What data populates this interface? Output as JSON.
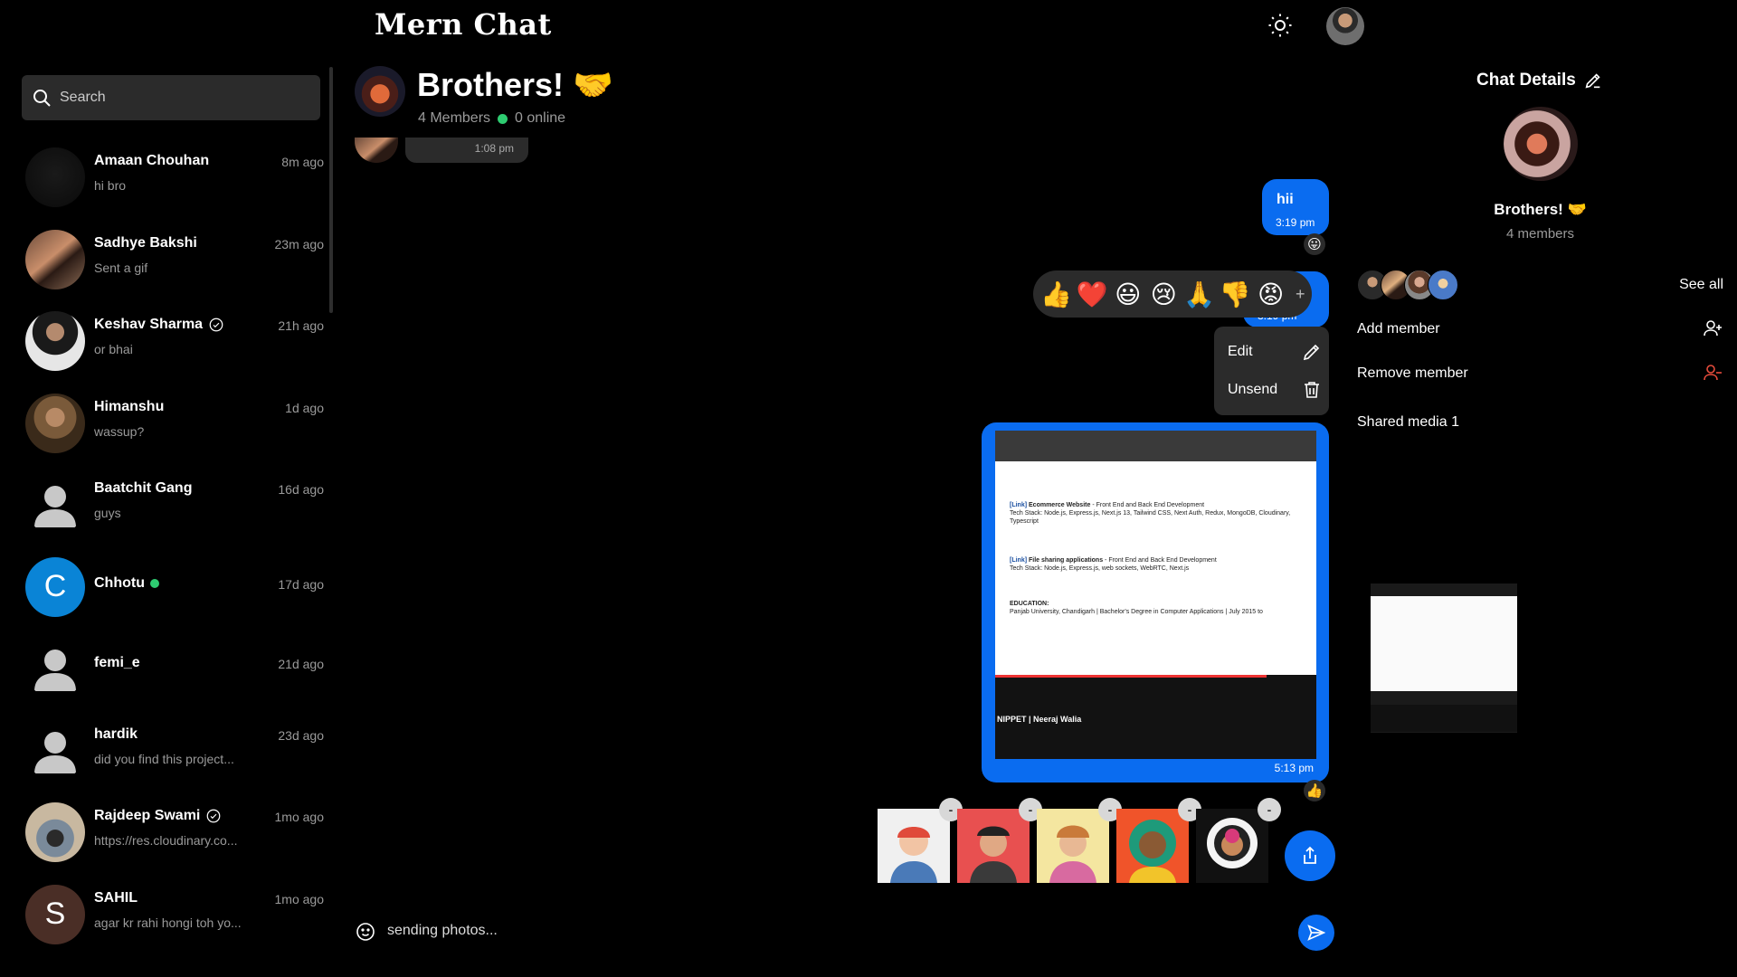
{
  "app": {
    "title": "Mern Chat"
  },
  "search": {
    "placeholder": "Search"
  },
  "chats": [
    {
      "name": "Amaan Chouhan",
      "preview": "hi bro",
      "time": "8m ago",
      "verified": false,
      "online": false
    },
    {
      "name": "Sadhye Bakshi",
      "preview": "Sent a gif",
      "time": "23m ago",
      "verified": false,
      "online": false
    },
    {
      "name": "Keshav Sharma",
      "preview": "or bhai",
      "time": "21h ago",
      "verified": true,
      "online": false
    },
    {
      "name": "Himanshu",
      "preview": "wassup?",
      "time": "1d ago",
      "verified": false,
      "online": false
    },
    {
      "name": "Baatchit Gang",
      "preview": "guys",
      "time": "16d ago",
      "verified": false,
      "online": false
    },
    {
      "name": "Chhotu",
      "preview": "",
      "time": "17d ago",
      "verified": false,
      "online": true,
      "initial": "C"
    },
    {
      "name": "femi_e",
      "preview": "",
      "time": "21d ago",
      "verified": false,
      "online": false
    },
    {
      "name": "hardik",
      "preview": "did you find this project...",
      "time": "23d ago",
      "verified": false,
      "online": false
    },
    {
      "name": "Rajdeep Swami",
      "preview": "https://res.cloudinary.co...",
      "time": "1mo ago",
      "verified": true,
      "online": false
    },
    {
      "name": "SAHIL",
      "preview": "agar kr rahi hongi toh yo...",
      "time": "1mo ago",
      "verified": false,
      "online": false,
      "initial": "S"
    }
  ],
  "conversation": {
    "title": "Brothers! 🤝",
    "members": "4 Members",
    "online": "0 online",
    "old_message_time": "1:08 pm",
    "messages": [
      {
        "text": "hii",
        "time": "3:19 pm",
        "reaction": "😛"
      },
      {
        "text": "",
        "time": "3:19 pm"
      },
      {
        "text": "",
        "time": "5:13 pm",
        "reaction": "👍",
        "image_caption": "NIPPET | Neeraj Walia"
      }
    ],
    "reaction_bar": [
      "👍",
      "❤️",
      "😃",
      "😢",
      "🙏",
      "👎",
      "😡"
    ],
    "reaction_more": "+",
    "context_menu": {
      "edit": "Edit",
      "unsend": "Unsend"
    },
    "image_doc": {
      "line1_label": "[Link]",
      "line1_title": "Ecommerce Website",
      "line1_rest": " - Front End and Back End Development",
      "line2": "Tech Stack: Node.js, Express.js, Next.js 13, Tailwind CSS, Next Auth, Redux, MongoDB, Cloudinary, Typescript",
      "line3_label": "[Link]",
      "line3_title": "File sharing applications",
      "line3_rest": " - Front End and Back End Development",
      "line4": "Tech Stack: Node.js, Express.js, web sockets, WebRTC, Next.js",
      "edu_title": "EDUCATION:",
      "edu_line": "Panjab University, Chandigarh | Bachelor's Degree in Computer Applications | July 2015 to"
    },
    "upload_remove": "-",
    "composer_text": "sending photos..."
  },
  "details": {
    "title": "Chat Details",
    "group_name": "Brothers! 🤝",
    "member_count": "4 members",
    "see_all": "See all",
    "add_member": "Add member",
    "remove_member": "Remove member",
    "shared_media": "Shared media 1"
  },
  "colors": {
    "accent": "#0a6cf0",
    "online": "#2ecc71",
    "danger": "#e74c3c",
    "surface": "#2b2b2b"
  }
}
